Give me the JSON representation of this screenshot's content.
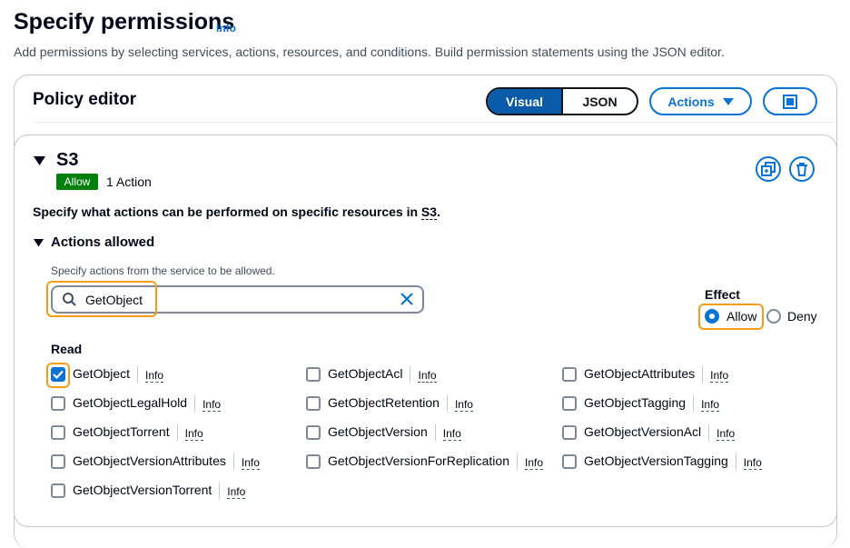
{
  "header": {
    "title": "Specify permissions",
    "info": "Info",
    "description": "Add permissions by selecting services, actions, resources, and conditions. Build permission statements using the JSON editor."
  },
  "editor": {
    "title": "Policy editor",
    "visual_label": "Visual",
    "json_label": "JSON",
    "actions_label": "Actions",
    "selected_mode": "Visual"
  },
  "service": {
    "name": "S3",
    "effect_badge": "Allow",
    "action_count": "1 Action",
    "specify_prefix": "Specify what actions can be performed on specific resources in ",
    "specify_service": "S3",
    "specify_suffix": "."
  },
  "actions_allowed": {
    "label": "Actions allowed",
    "hint": "Specify actions from the service to be allowed.",
    "search_value": "GetObject"
  },
  "effect": {
    "label": "Effect",
    "allow": "Allow",
    "deny": "Deny",
    "selected": "Allow"
  },
  "read": {
    "label": "Read",
    "info": "Info",
    "items": [
      {
        "name": "GetObject",
        "checked": true
      },
      {
        "name": "GetObjectAcl",
        "checked": false
      },
      {
        "name": "GetObjectAttributes",
        "checked": false
      },
      {
        "name": "GetObjectLegalHold",
        "checked": false
      },
      {
        "name": "GetObjectRetention",
        "checked": false
      },
      {
        "name": "GetObjectTagging",
        "checked": false
      },
      {
        "name": "GetObjectTorrent",
        "checked": false
      },
      {
        "name": "GetObjectVersion",
        "checked": false
      },
      {
        "name": "GetObjectVersionAcl",
        "checked": false
      },
      {
        "name": "GetObjectVersionAttributes",
        "checked": false
      },
      {
        "name": "GetObjectVersionForReplication",
        "checked": false
      },
      {
        "name": "GetObjectVersionTagging",
        "checked": false
      },
      {
        "name": "GetObjectVersionTorrent",
        "checked": false
      }
    ]
  },
  "colors": {
    "accent": "#0972d3",
    "highlight": "#f49d1a",
    "badge_green": "#037f0c"
  }
}
